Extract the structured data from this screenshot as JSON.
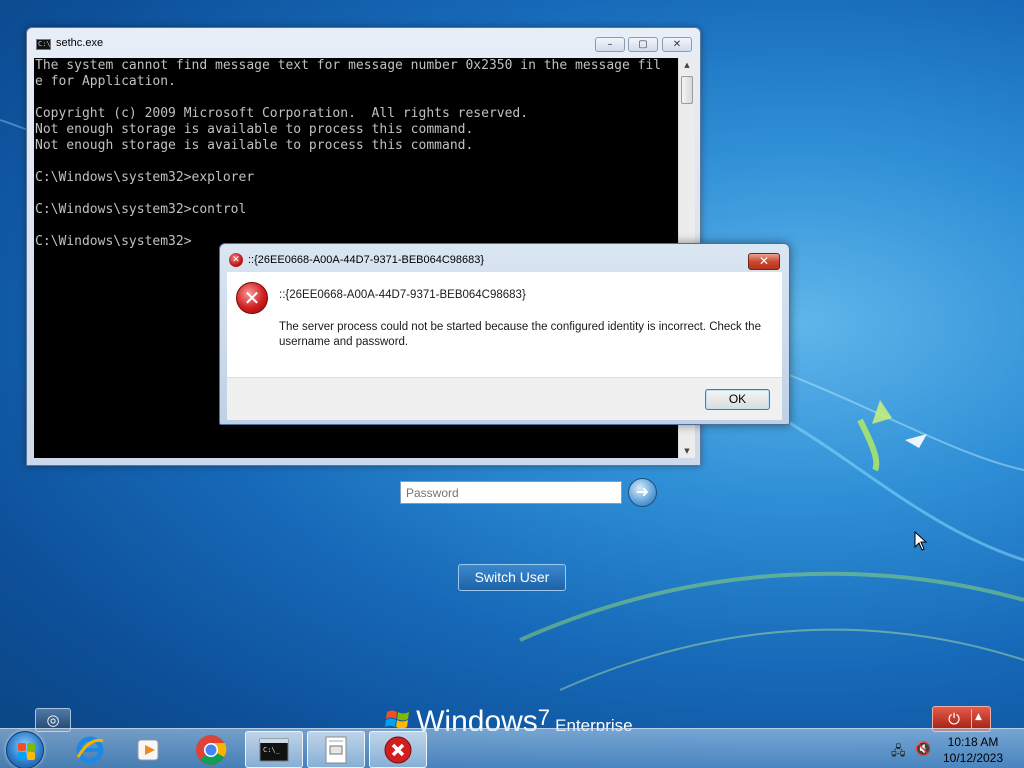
{
  "console": {
    "title": "sethc.exe",
    "icon_text": "C:\\",
    "lines": [
      "The system cannot find message text for message number 0x2350 in the message fil",
      "e for Application.",
      "",
      "Copyright (c) 2009 Microsoft Corporation.  All rights reserved.",
      "Not enough storage is available to process this command.",
      "Not enough storage is available to process this command.",
      "",
      "C:\\Windows\\system32>explorer",
      "",
      "C:\\Windows\\system32>control",
      "",
      "C:\\Windows\\system32>"
    ]
  },
  "dialog": {
    "title": "::{26EE0668-A00A-44D7-9371-BEB064C98683}",
    "heading": "::{26EE0668-A00A-44D7-9371-BEB064C98683}",
    "message": "The server process could not be started because the configured identity is incorrect. Check the username and password.",
    "ok_label": "OK"
  },
  "login": {
    "password_placeholder": "Password",
    "switch_user_label": "Switch User",
    "branding_windows": "Windows",
    "branding_version": "7",
    "branding_edition": "Enterprise"
  },
  "taskbar": {
    "pinned": [
      "internet-explorer-icon",
      "media-player-icon",
      "chrome-icon"
    ],
    "running": [
      "command-prompt-icon",
      "application-window-icon",
      "error-icon"
    ]
  },
  "tray": {
    "time": "10:18 AM",
    "date": "10/12/2023"
  },
  "colors": {
    "desktop": "#1669b8",
    "console_bg": "#000000",
    "console_text": "#c0c0c0",
    "error_red": "#d11f1f",
    "shutdown_red": "#c0392b"
  }
}
